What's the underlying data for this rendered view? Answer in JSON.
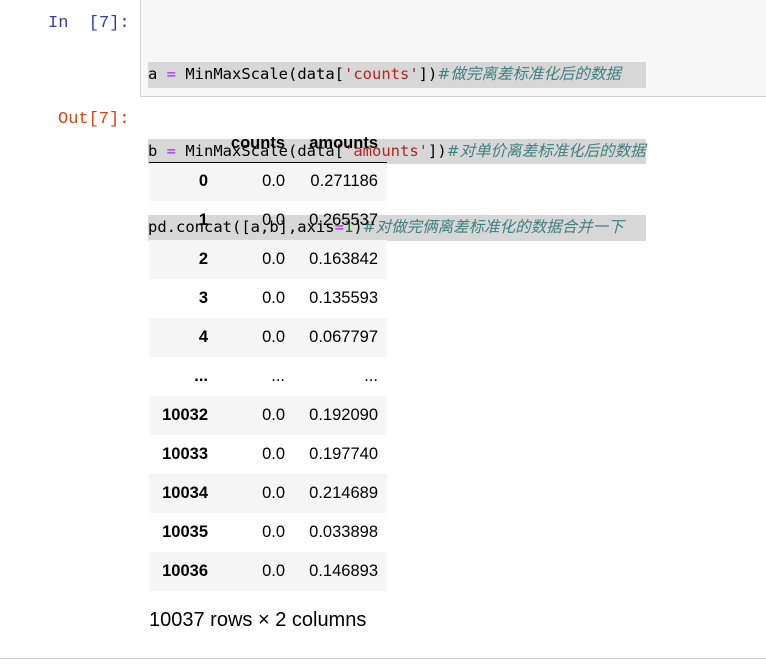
{
  "input_prompt": "In  [7]:",
  "output_prompt": "Out[7]:",
  "code": {
    "line1": {
      "a": "a ",
      "eq": "=",
      "call": " MinMaxScale(data[",
      "str": "'counts'",
      "close": "])",
      "comment": "#做完离差标准化后的数据"
    },
    "line2": {
      "a": "b ",
      "eq": "=",
      "call": " MinMaxScale(data[",
      "str": "'amounts'",
      "close": "])",
      "comment": "#对单价离差标准化后的数据"
    },
    "line3": {
      "pre": "pd.concat([a,b],axis",
      "eq": "=",
      "num": "1",
      "close": ")",
      "comment": "#对做完俩离差标准化的数据合并一下"
    }
  },
  "table": {
    "columns": [
      "",
      "counts",
      "amounts"
    ],
    "rows": [
      [
        "0",
        "0.0",
        "0.271186"
      ],
      [
        "1",
        "0.0",
        "0.265537"
      ],
      [
        "2",
        "0.0",
        "0.163842"
      ],
      [
        "3",
        "0.0",
        "0.135593"
      ],
      [
        "4",
        "0.0",
        "0.067797"
      ],
      [
        "...",
        "...",
        "..."
      ],
      [
        "10032",
        "0.0",
        "0.192090"
      ],
      [
        "10033",
        "0.0",
        "0.197740"
      ],
      [
        "10034",
        "0.0",
        "0.214689"
      ],
      [
        "10035",
        "0.0",
        "0.033898"
      ],
      [
        "10036",
        "0.0",
        "0.146893"
      ]
    ]
  },
  "shape_text": "10037 rows × 2 columns"
}
